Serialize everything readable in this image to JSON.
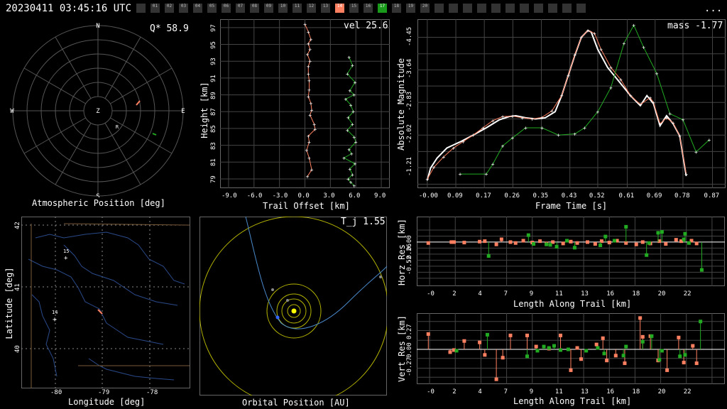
{
  "header": {
    "timestamp": "20230411 03:45:16 UTC",
    "menu": "...",
    "cameras": [
      "",
      "01",
      "02",
      "03",
      "04",
      "05",
      "06",
      "07",
      "08",
      "09",
      "10",
      "11",
      "12",
      "13",
      "14",
      "15",
      "16",
      "17",
      "18",
      "19",
      "20",
      "",
      "",
      "",
      "",
      "",
      "",
      "",
      "",
      "",
      "",
      ""
    ],
    "active_cameras": {
      "14": "#ff8060",
      "17": "#1a9a1a"
    }
  },
  "colors": {
    "orange": "#ff8060",
    "green": "#22aa22",
    "grid": "#444444",
    "yellow": "#dddd00",
    "blue": "#5599ff"
  },
  "panels": {
    "atmo": {
      "title": "Atmospheric Position [deg]",
      "stat": "Q* 58.9",
      "dirs": {
        "n": "N",
        "s": "S",
        "e": "E",
        "w": "W",
        "z": "Z"
      },
      "marker": "R"
    },
    "height": {
      "stat": "vel 25.6",
      "xlabel": "Trail Offset [km]",
      "ylabel": "Height [km]"
    },
    "mag": {
      "stat": "mass -1.77",
      "xlabel": "Frame Time [s]",
      "ylabel": "Absolute Magnitude"
    },
    "map": {
      "xlabel": "Longitude [deg]",
      "ylabel": "Latitude [deg]",
      "site1": "15",
      "site2": "14"
    },
    "orbit": {
      "stat": "T_j 1.55",
      "xlabel": "Orbital Position [AU]"
    },
    "hres": {
      "xlabel": "Length Along Trail [km]",
      "ylabel": "Horz Res [km]"
    },
    "vres": {
      "xlabel": "Length Along Trail [km]",
      "ylabel": "Vert Res [km]"
    }
  },
  "chart_data": [
    {
      "type": "scatter",
      "name": "height",
      "xlim": [
        -10,
        10
      ],
      "ylim": [
        77.9,
        98
      ],
      "xticks": [
        "-9.0",
        "-6.0",
        "-3.0",
        "0.0",
        "3.0",
        "6.0",
        "9.0"
      ],
      "yticks": [
        "79",
        "81",
        "83",
        "85",
        "87",
        "89",
        "91",
        "93",
        "95",
        "97"
      ],
      "series": [
        {
          "color": "orange",
          "x": [
            0.0,
            0.4,
            0.7,
            0.4,
            0.6,
            0.3,
            0.6,
            0.4,
            0.4,
            0.5,
            0.5,
            0.4,
            0.7,
            0.8,
            0.6,
            1.1,
            1.2,
            0.4,
            0.5,
            0.2,
            0.5,
            0.8,
            0.3
          ],
          "y": [
            97.4,
            96.5,
            95.6,
            95.1,
            94.4,
            93.8,
            93.0,
            92.4,
            91.5,
            90.7,
            89.6,
            88.8,
            88.0,
            87.2,
            86.6,
            85.5,
            84.9,
            84.1,
            83.4,
            82.4,
            81.5,
            80.1,
            79.3
          ]
        },
        {
          "color": "green",
          "x": [
            5.2,
            5.6,
            5.0,
            5.9,
            5.3,
            5.8,
            4.8,
            5.4,
            5.7,
            5.1,
            5.6,
            5.0,
            5.8,
            6.0,
            5.2,
            5.5,
            4.6,
            5.9,
            5.3,
            5.6,
            5.1,
            5.4,
            5.8
          ],
          "y": [
            93.5,
            92.5,
            91.5,
            90.5,
            89.5,
            89.0,
            88.5,
            87.8,
            87.0,
            86.3,
            85.5,
            84.8,
            84.0,
            83.4,
            82.5,
            82.0,
            81.5,
            80.8,
            80.2,
            79.5,
            79.0,
            78.6,
            78.2
          ]
        }
      ]
    },
    {
      "type": "line",
      "name": "magnitude",
      "xlim": [
        -0.03,
        0.91
      ],
      "ylim": [
        -4.9,
        -0.7
      ],
      "xticks": [
        "-0.00",
        "0.09",
        "0.17",
        "0.26",
        "0.35",
        "0.43",
        "0.52",
        "0.61",
        "0.69",
        "0.78",
        "0.87"
      ],
      "yticks": [
        "-4.45",
        "-3.64",
        "-2.83",
        "-2.02",
        "-1.21"
      ],
      "fit": {
        "x": [
          0.0,
          0.01,
          0.03,
          0.06,
          0.1,
          0.14,
          0.18,
          0.22,
          0.25,
          0.27,
          0.3,
          0.33,
          0.36,
          0.39,
          0.41,
          0.43,
          0.45,
          0.47,
          0.49,
          0.5,
          0.52,
          0.55,
          0.58,
          0.62,
          0.65,
          0.67,
          0.69,
          0.71,
          0.73,
          0.75,
          0.77,
          0.79
        ],
        "y": [
          -0.9,
          -1.2,
          -1.45,
          -1.7,
          -1.85,
          -2.02,
          -2.2,
          -2.4,
          -2.48,
          -2.5,
          -2.45,
          -2.42,
          -2.45,
          -2.6,
          -3.0,
          -3.5,
          -4.0,
          -4.45,
          -4.62,
          -4.58,
          -4.15,
          -3.7,
          -3.4,
          -3.0,
          -2.75,
          -3.0,
          -2.8,
          -2.25,
          -2.5,
          -2.3,
          -2.0,
          -1.0
        ]
      },
      "series": [
        {
          "color": "orange",
          "x": [
            0.0,
            0.02,
            0.05,
            0.08,
            0.11,
            0.14,
            0.17,
            0.2,
            0.23,
            0.26,
            0.29,
            0.32,
            0.35,
            0.38,
            0.41,
            0.43,
            0.45,
            0.47,
            0.49,
            0.51,
            0.53,
            0.56,
            0.59,
            0.62,
            0.65,
            0.68,
            0.69,
            0.71,
            0.73,
            0.75,
            0.77,
            0.79
          ],
          "y": [
            -0.92,
            -1.22,
            -1.48,
            -1.7,
            -1.86,
            -2.02,
            -2.2,
            -2.38,
            -2.48,
            -2.49,
            -2.45,
            -2.42,
            -2.46,
            -2.62,
            -3.0,
            -3.5,
            -4.02,
            -4.45,
            -4.62,
            -4.55,
            -4.15,
            -3.7,
            -3.4,
            -3.0,
            -2.78,
            -2.95,
            -2.83,
            -2.3,
            -2.45,
            -2.32,
            -2.0,
            -1.05
          ]
        },
        {
          "color": "green",
          "x": [
            0.1,
            0.18,
            0.2,
            0.23,
            0.26,
            0.3,
            0.35,
            0.4,
            0.45,
            0.48,
            0.52,
            0.56,
            0.6,
            0.63,
            0.66,
            0.7,
            0.74,
            0.78,
            0.82,
            0.86
          ],
          "y": [
            -1.05,
            -1.05,
            -1.3,
            -1.75,
            -1.95,
            -2.2,
            -2.2,
            -2.02,
            -2.05,
            -2.2,
            -2.6,
            -3.2,
            -4.3,
            -4.75,
            -4.2,
            -3.55,
            -2.55,
            -2.4,
            -1.6,
            -1.9
          ]
        }
      ]
    },
    {
      "type": "scatter",
      "name": "horz_res",
      "xlim": [
        -1,
        23
      ],
      "ylim": [
        -0.95,
        0.55
      ],
      "xticks": [
        "-0",
        "2",
        "4",
        "7",
        "9",
        "11",
        "13",
        "16",
        "18",
        "20",
        "22"
      ],
      "yticks": [
        "0.00",
        "-0.26",
        "-0.52"
      ],
      "series": [
        {
          "color": "orange",
          "x": [
            -0.1,
            1.7,
            1.9,
            2.7,
            3.9,
            4.3,
            5.2,
            5.6,
            6.3,
            6.7,
            7.3,
            8.0,
            8.6,
            9.1,
            9.6,
            10.4,
            11.0,
            11.5,
            12.3,
            12.9,
            13.4,
            14.0,
            14.6,
            15.3,
            16.1,
            16.6,
            17.2,
            17.9,
            18.4,
            19.2,
            19.6,
            20.4,
            20.8
          ],
          "y": [
            -0.02,
            0.0,
            0.0,
            -0.01,
            0.01,
            0.02,
            -0.05,
            0.06,
            0.0,
            -0.02,
            0.03,
            -0.01,
            0.02,
            -0.03,
            0.0,
            -0.03,
            0.01,
            -0.02,
            0.0,
            -0.04,
            0.02,
            -0.01,
            0.03,
            -0.02,
            -0.05,
            0.0,
            -0.03,
            0.02,
            -0.04,
            0.05,
            0.02,
            0.03,
            -0.03
          ]
        },
        {
          "color": "green",
          "x": [
            4.6,
            7.7,
            8.1,
            9.1,
            9.4,
            9.9,
            10.7,
            11.3,
            13.3,
            13.7,
            14.4,
            15.3,
            16.9,
            17.1,
            17.8,
            18.1,
            19.8,
            19.9,
            20.2,
            21.2
          ],
          "y": [
            -0.3,
            0.15,
            -0.04,
            -0.05,
            -0.06,
            -0.1,
            0.03,
            -0.12,
            -0.07,
            0.12,
            0.03,
            0.33,
            -0.28,
            -0.02,
            0.2,
            0.22,
            0.06,
            0.18,
            -0.02,
            -0.6
          ]
        }
      ]
    },
    {
      "type": "scatter",
      "name": "vert_res",
      "xlim": [
        -1,
        23
      ],
      "ylim": [
        -0.5,
        0.52
      ],
      "xticks": [
        "-0",
        "2",
        "4",
        "7",
        "9",
        "11",
        "13",
        "16",
        "18",
        "20",
        "22"
      ],
      "yticks": [
        "0.27",
        "0.00",
        "-0.27"
      ],
      "series": [
        {
          "color": "orange",
          "x": [
            -0.1,
            1.6,
            1.9,
            2.7,
            3.9,
            4.3,
            5.2,
            5.7,
            6.3,
            7.6,
            8.3,
            9.3,
            10.2,
            11.0,
            11.5,
            11.8,
            13.0,
            13.5,
            13.8,
            14.5,
            15.2,
            16.4,
            16.6,
            17.2,
            17.8,
            18.5,
            19.4,
            19.8,
            20.5,
            20.8
          ],
          "y": [
            0.22,
            -0.04,
            -0.01,
            0.12,
            0.1,
            -0.08,
            -0.43,
            -0.12,
            0.2,
            0.2,
            0.04,
            0.01,
            0.2,
            -0.3,
            0.02,
            -0.14,
            0.07,
            0.16,
            -0.16,
            -0.09,
            -0.2,
            0.45,
            0.18,
            0.19,
            -0.16,
            -0.3,
            0.17,
            -0.19,
            0.05,
            -0.2
          ]
        },
        {
          "color": "green",
          "x": [
            2.1,
            4.5,
            7.6,
            8.4,
            8.9,
            9.3,
            9.7,
            10.2,
            10.8,
            12.2,
            13.1,
            13.6,
            15.1,
            15.3,
            16.6,
            17.3,
            17.9,
            18.1,
            19.5,
            19.9,
            21.1
          ],
          "y": [
            -0.02,
            0.21,
            -0.1,
            -0.02,
            0.04,
            0.02,
            0.05,
            -0.01,
            0.0,
            -0.02,
            0.02,
            -0.06,
            -0.09,
            0.04,
            0.11,
            0.19,
            -0.15,
            -0.02,
            -0.1,
            -0.08,
            0.4
          ]
        }
      ]
    }
  ]
}
